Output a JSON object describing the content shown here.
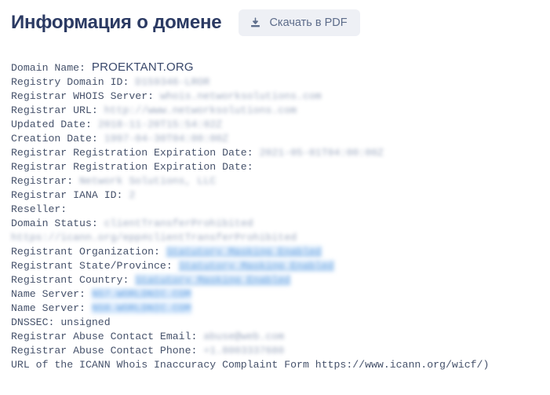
{
  "header": {
    "title": "Информация о домене",
    "download_button": {
      "label": "Скачать в PDF",
      "icon": "download-icon"
    }
  },
  "colors": {
    "title": "#2b3a63",
    "button_bg": "#eef0f5",
    "button_text": "#5d6c8a",
    "body_text": "#46526b",
    "redacted": "#9aa6bd",
    "link_blue": "#5b9ce0",
    "link_highlight": "#dcebfb",
    "page_bg": "#ffffff"
  },
  "whois": {
    "records": [
      {
        "label": "Domain Name:",
        "value": "PROEKTANT.ORG",
        "style": "domain"
      },
      {
        "label": "Registry Domain ID:",
        "value": "D159346-LROR",
        "style": "redacted"
      },
      {
        "label": "Registrar WHOIS Server:",
        "value": "whois.networksolutions.com",
        "style": "redacted"
      },
      {
        "label": "Registrar URL:",
        "value": "http://www.networksolutions.com",
        "style": "redacted"
      },
      {
        "label": "Updated Date:",
        "value": "2018-11-20T15:54:02Z",
        "style": "redacted"
      },
      {
        "label": "Creation Date:",
        "value": "1997-04-30T04:00:00Z",
        "style": "redacted"
      },
      {
        "label": "Registrar Registration Expiration Date:",
        "value": "2021-05-01T04:00:00Z",
        "style": "redacted"
      },
      {
        "label": "Registrar Registration Expiration Date:",
        "value": "",
        "style": "empty"
      },
      {
        "label": "Registrar:",
        "value": "Network Solutions, LLC",
        "style": "redacted"
      },
      {
        "label": "Registrar IANA ID:",
        "value": "2",
        "style": "redacted"
      },
      {
        "label": "Reseller:",
        "value": "",
        "style": "empty"
      },
      {
        "label": "Domain Status:",
        "value": "clientTransferProhibited https://icann.org/epp#clientTransferProhibited",
        "style": "redacted"
      },
      {
        "label": "Registrant Organization:",
        "value": "Statutory Masking Enabled",
        "style": "link"
      },
      {
        "label": "Registrant State/Province:",
        "value": "Statutory Masking Enabled",
        "style": "link"
      },
      {
        "label": "Registrant Country:",
        "value": "Statutory Masking Enabled",
        "style": "link"
      },
      {
        "label": "Name Server:",
        "value": "NS7.WORLDNIC.COM",
        "style": "nameserver"
      },
      {
        "label": "Name Server:",
        "value": "NS8.WORLDNIC.COM",
        "style": "nameserver"
      },
      {
        "label": "DNSSEC:",
        "value": "unsigned",
        "style": "plain"
      },
      {
        "label": "Registrar Abuse Contact Email:",
        "value": "abuse@web.com",
        "style": "redacted"
      },
      {
        "label": "Registrar Abuse Contact Phone:",
        "value": "+1.8003337680",
        "style": "redacted"
      },
      {
        "label": "URL of the ICANN Whois Inaccuracy Complaint Form https://www.icann.org/wicf/)",
        "value": "",
        "style": "plain-full"
      }
    ]
  }
}
